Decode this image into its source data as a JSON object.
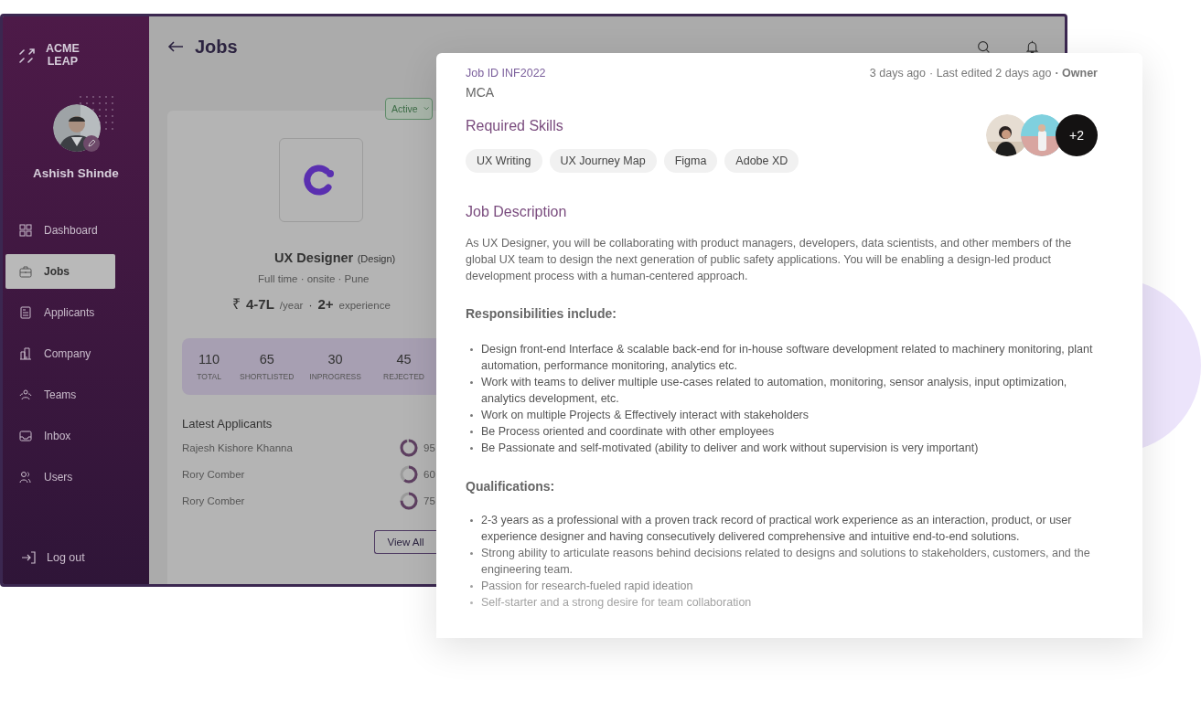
{
  "logo": {
    "lines": [
      "ACME",
      "LEAP"
    ]
  },
  "profile": {
    "name": "Ashish Shinde"
  },
  "nav": [
    {
      "label": "Dashboard",
      "selected": false
    },
    {
      "label": "Jobs",
      "selected": true
    },
    {
      "label": "Applicants",
      "selected": false
    },
    {
      "label": "Company",
      "selected": false
    },
    {
      "label": "Teams",
      "selected": false
    },
    {
      "label": "Inbox",
      "selected": false
    },
    {
      "label": "Users",
      "selected": false
    }
  ],
  "logout": "Log out",
  "header": {
    "title": "Jobs"
  },
  "status_dropdown": {
    "value": "Active"
  },
  "job": {
    "title": "UX Designer",
    "department": "(Design)",
    "meta": "Full time · onsite · Pune",
    "currency": "₹",
    "salary": "4-7L",
    "per": "/year",
    "separator": "·",
    "experience": "2+",
    "experience_label": "experience"
  },
  "stats": [
    {
      "value": "110",
      "label": "TOTAL"
    },
    {
      "value": "65",
      "label": "SHORTLISTED"
    },
    {
      "value": "30",
      "label": "INPROGRESS"
    },
    {
      "value": "45",
      "label": "REJECTED"
    }
  ],
  "latest_applicants": {
    "title": "Latest Applicants",
    "rows": [
      {
        "name": "Rajesh Kishore Khanna",
        "level": 0.95,
        "score": "95"
      },
      {
        "name": "Rory Comber",
        "level": 0.6,
        "score": "60"
      },
      {
        "name": "Rory Comber",
        "level": 0.75,
        "score": "75"
      }
    ],
    "button": "View All"
  },
  "detail": {
    "job_id": "Job ID INF2022",
    "posted": "3 days ago",
    "edited": "· Last edited 2 days ago",
    "owner": "· Owner",
    "qualification": "MCA",
    "skills_title": "Required Skills",
    "skills": [
      "UX Writing",
      "UX Journey Map",
      "Figma",
      "Adobe XD"
    ],
    "team": [
      {
        "kind": "picture"
      },
      {
        "kind": "picture"
      },
      {
        "kind": "more",
        "count": "+2"
      }
    ],
    "description_title": "Job Description",
    "description": "As UX Designer, you will be collaborating with product managers, developers, data scientists, and other members of the global UX team to design the next generation of public safety applications. You will be enabling a design-led product development process with a human-centered approach.",
    "responsibilities_title": "Responsibilities include:",
    "responsibilities": [
      "Design front-end Interface & scalable back-end for in-house software development related to machinery monitoring, plant automation, performance monitoring, analytics etc.",
      "Work with teams to deliver multiple use-cases related to automation, monitoring, sensor analysis, input optimization, analytics development, etc.",
      "Work on multiple Projects & Effectively interact with stakeholders",
      "Be Process oriented and coordinate with other employees",
      "Be Passionate and self-motivated (ability to deliver and work without supervision is very important)"
    ],
    "qualifications_title": "Qualifications:",
    "qualifications": [
      "2-3 years as a professional with a proven track record of practical work experience as an interaction, product, or user experience designer and having consecutively delivered comprehensive and intuitive end-to-end solutions.",
      "Strong ability to articulate reasons behind decisions related to designs and solutions to stakeholders, customers, and the engineering team.",
      "Passion for research-fueled rapid ideation",
      "Self-starter and a strong desire for team collaboration"
    ]
  }
}
